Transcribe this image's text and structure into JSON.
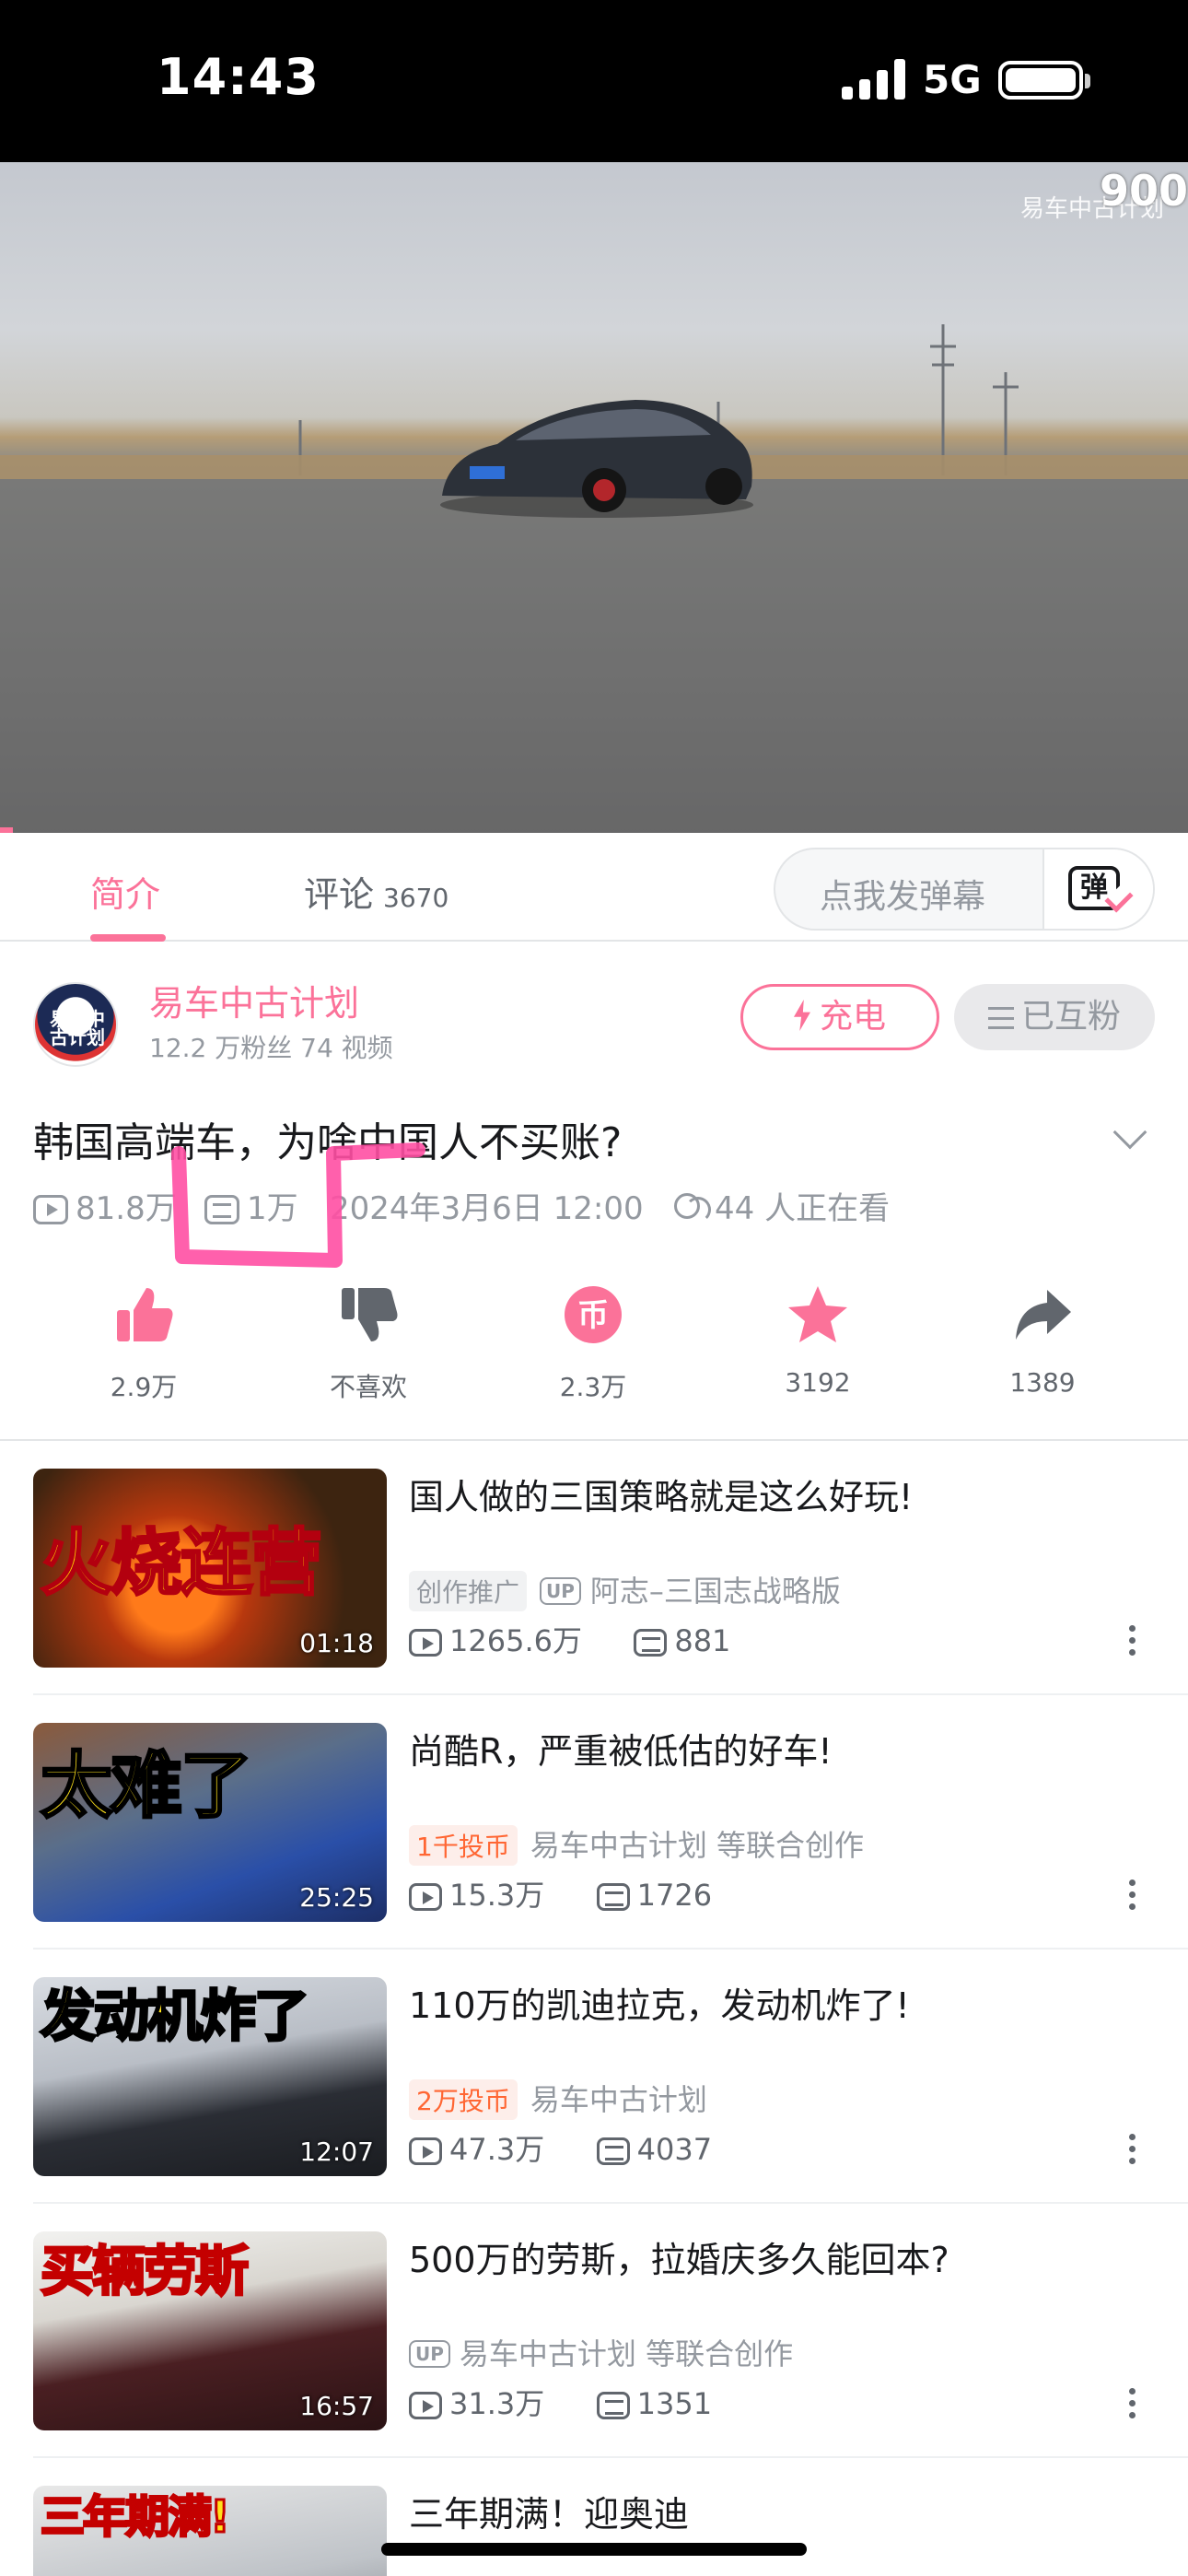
{
  "status_bar": {
    "time": "14:43",
    "network": "5G"
  },
  "video": {
    "watermark": "易车中古计划",
    "count_overlay": "900"
  },
  "tabs": {
    "intro": "简介",
    "comments": "评论",
    "comment_count": "3670",
    "danmaku_placeholder": "点我发弹幕",
    "danmaku_toggle": "弹"
  },
  "uploader": {
    "name": "易车中古计划",
    "stats": "12.2 万粉丝  74 视频",
    "avatar_text": "易车中古计划",
    "charge_label": "充电",
    "follow_label": "已互粉"
  },
  "video_info": {
    "title": "韩国高端车，为啥中国人不买账?",
    "views": "81.8万",
    "danmaku": "1万",
    "date": "2024年3月6日 12:00",
    "watching": "44 人正在看"
  },
  "actions": {
    "like": "2.9万",
    "dislike": "不喜欢",
    "coin": "2.3万",
    "favorite": "3192",
    "share": "1389"
  },
  "recommendations": [
    {
      "title": "国人做的三国策略就是这么好玩!",
      "thumb_text": "火烧连营",
      "duration": "01:18",
      "badge": "创作推广",
      "up_tag": "UP",
      "author": "阿志–三国志战略版",
      "views": "1265.6万",
      "danmaku": "881"
    },
    {
      "title": "尚酷R，严重被低估的好车!",
      "thumb_text": "太难了",
      "duration": "25:25",
      "badge": "1千投币",
      "author": "易车中古计划  等联合创作",
      "views": "15.3万",
      "danmaku": "1726"
    },
    {
      "title": "110万的凯迪拉克，发动机炸了!",
      "thumb_text": "发动机炸了",
      "duration": "12:07",
      "badge": "2万投币",
      "author": "易车中古计划",
      "views": "47.3万",
      "danmaku": "4037"
    },
    {
      "title": "500万的劳斯，拉婚庆多久能回本?",
      "thumb_text": "买辆劳斯",
      "duration": "16:57",
      "up_tag": "UP",
      "author": "易车中古计划  等联合创作",
      "views": "31.3万",
      "danmaku": "1351"
    },
    {
      "title": "三年期满！迎奥迪",
      "thumb_text": "三年期满!"
    }
  ],
  "colors": {
    "accent": "#fb7299",
    "annotation": "#ff4fa3"
  }
}
